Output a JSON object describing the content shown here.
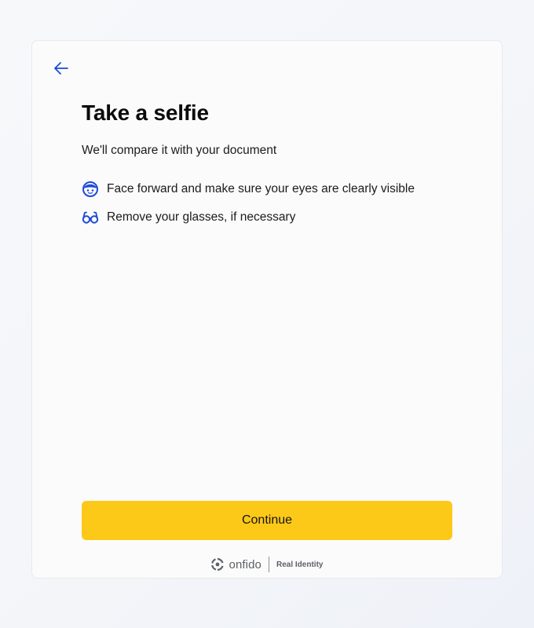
{
  "header": {
    "back_icon": "arrow-left-icon"
  },
  "main": {
    "title": "Take a selfie",
    "subtitle": "We'll compare it with your document",
    "instructions": [
      {
        "icon": "face-icon",
        "text": "Face forward and make sure your eyes are clearly visible"
      },
      {
        "icon": "glasses-icon",
        "text": "Remove your glasses, if necessary"
      }
    ],
    "continue_label": "Continue"
  },
  "footer": {
    "brand": "onfido",
    "tagline": "Real Identity"
  },
  "colors": {
    "accent": "#1d4ad8",
    "button": "#fdc919",
    "background": "#f5f6f9",
    "card": "#fbfbfb"
  }
}
